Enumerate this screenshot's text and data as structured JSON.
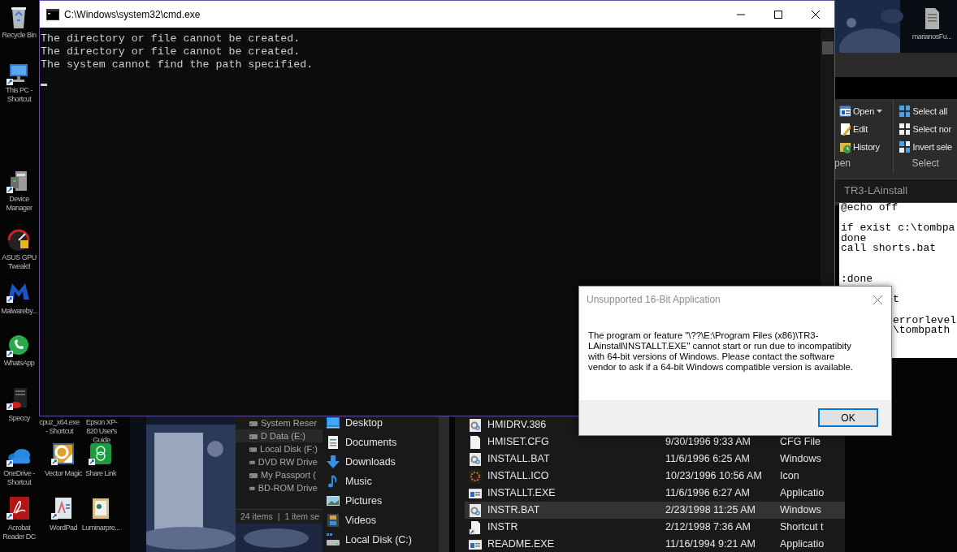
{
  "desktop_icons": [
    {
      "label": "Recycle Bin"
    },
    {
      "label": "This PC - Shortcut"
    },
    {
      "label": "Device Manager"
    },
    {
      "label": "ASUS GPU Tweak!!"
    },
    {
      "label": "Malwareby..."
    },
    {
      "label": "WhatsApp"
    },
    {
      "label": "Speccy"
    },
    {
      "label": "OneDrive - Shortcut"
    },
    {
      "label": "Acrobat Reader DC"
    },
    {
      "label": "cpuz_x64.exe - Shortcut"
    },
    {
      "label": "Epson XP-820 User's Guide"
    },
    {
      "label": "Vector Magic"
    },
    {
      "label": "Share Link"
    },
    {
      "label": "WordPad"
    },
    {
      "label": "Luminarpre..."
    },
    {
      "label": "marianosFu..."
    }
  ],
  "cmd": {
    "title": "C:\\Windows\\system32\\cmd.exe",
    "lines": [
      "The directory or file cannot be created.",
      "The directory or file cannot be created.",
      "The system cannot find the path specified."
    ]
  },
  "explorer": {
    "ribbon": {
      "groups": [
        {
          "label": "pen",
          "items": [
            {
              "label": "Open",
              "dropdown": true
            },
            {
              "label": "Edit",
              "dropdown": false
            },
            {
              "label": "History",
              "dropdown": false
            }
          ]
        },
        {
          "label": "Select",
          "items": [
            {
              "label": "Select all",
              "dropdown": false
            },
            {
              "label": "Select nor",
              "dropdown": false
            },
            {
              "label": "Invert sele",
              "dropdown": false
            }
          ]
        }
      ]
    },
    "address": "TR3-LAinstall"
  },
  "editor": {
    "lines": [
      {
        "kind": "text",
        "text": "@echo off"
      },
      {
        "kind": "blank"
      },
      {
        "kind": "text",
        "text": "if exist c:\\tombpa"
      },
      {
        "kind": "text",
        "text": "done"
      },
      {
        "kind": "text",
        "text": "call shorts.bat"
      },
      {
        "kind": "blank"
      },
      {
        "kind": "blank"
      },
      {
        "kind": "text",
        "text": ":done"
      },
      {
        "kind": "blank"
      },
      {
        "kind": "partial",
        "text": "t"
      },
      {
        "kind": "blank"
      },
      {
        "kind": "partial",
        "text": "errorlevel"
      },
      {
        "kind": "partial",
        "text": "\\tombpath"
      }
    ]
  },
  "drives_window": {
    "items": [
      {
        "label": "System Reser",
        "selected": false
      },
      {
        "label": "D Data (E:)",
        "selected": true
      },
      {
        "label": "Local Disk (F:)",
        "selected": false
      },
      {
        "label": "DVD RW Drive",
        "selected": false
      },
      {
        "label": "My Passport (",
        "selected": false
      },
      {
        "label": "BD-ROM Drive",
        "selected": false
      }
    ],
    "status": [
      "24 items",
      "|",
      "1 item se"
    ]
  },
  "nav_pane": {
    "items": [
      "Desktop",
      "Documents",
      "Downloads",
      "Music",
      "Pictures",
      "Videos",
      "Local Disk (C:)"
    ]
  },
  "file_list": {
    "rows": [
      {
        "name": "HMIDRV.386",
        "selected": false
      },
      {
        "name": "HMISET.CFG",
        "date": "9/30/1996 9:33 AM",
        "type": "CFG File",
        "selected": false
      },
      {
        "name": "INSTALL.BAT",
        "date": "11/6/1996 6:25 AM",
        "type": "Windows",
        "selected": false
      },
      {
        "name": "INSTALL.ICO",
        "date": "10/23/1996 10:56 AM",
        "type": "Icon",
        "selected": false
      },
      {
        "name": "INSTALLT.EXE",
        "date": "11/6/1996 6:27 AM",
        "type": "Applicatio",
        "selected": false
      },
      {
        "name": "INSTR.BAT",
        "date": "2/23/1998 11:25 AM",
        "type": "Windows",
        "selected": true
      },
      {
        "name": "INSTR",
        "date": "2/12/1998 7:36 AM",
        "type": "Shortcut t",
        "selected": false
      },
      {
        "name": "README.EXE",
        "date": "11/16/1994 9:21 AM",
        "type": "Applicatio",
        "selected": false
      }
    ]
  },
  "dialog": {
    "title": "Unsupported 16-Bit Application",
    "message": "The program or feature \"\\??\\E:\\Program Files (x86)\\TR3-LAinstall\\INSTALLT.EXE\" cannot start or run due to incompatibity with 64-bit versions of Windows. Please contact the software vendor to ask if a 64-bit Windows compatible version is available.",
    "button": "OK"
  }
}
